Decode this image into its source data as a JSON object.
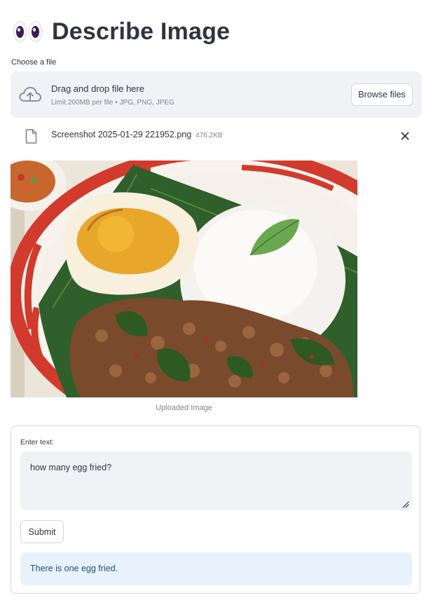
{
  "header": {
    "title": "Describe Image",
    "icon": "eyes-emoji-icon"
  },
  "uploader": {
    "label": "Choose a file",
    "drop_title": "Drag and drop file here",
    "drop_subtitle": "Limit 200MB per file • JPG, PNG, JPEG",
    "browse_label": "Browse files",
    "icon": "cloud-upload-icon"
  },
  "file": {
    "name": "Screenshot 2025-01-29 221952.png",
    "size": "476.2KB",
    "icon": "file-icon",
    "remove_icon": "close-icon"
  },
  "image": {
    "caption": "Uploaded Image"
  },
  "form": {
    "label": "Enter text:",
    "input_value": "how many egg fried?",
    "submit_label": "Submit",
    "result_text": "There is one egg fried."
  },
  "colors": {
    "panel_bg": "#f0f2f6",
    "result_bg": "#e8f2fc",
    "result_text": "#1d4e7a",
    "text": "#31333f"
  }
}
